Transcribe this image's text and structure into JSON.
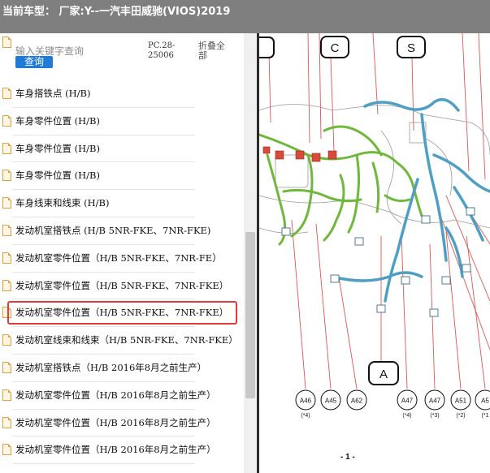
{
  "title": "当前车型：  厂家:Y--一汽丰田威驰(VIOS)2019",
  "search": {
    "placeholder": "输入关键字查询",
    "button": "查询"
  },
  "pc_code": "PC.28-25006",
  "collapse_all": "折叠全部",
  "list_items": [
    "车身搭铁点 (H/B)",
    "车身零件位置 (H/B)",
    "车身零件位置 (H/B)",
    "车身零件位置 (H/B)",
    "车身线束和线束 (H/B)",
    "发动机室搭铁点 (H/B 5NR-FKE、7NR-FKE)",
    "发动机室零件位置（H/B 5NR-FKE、7NR-FE）",
    "发动机室零件位置（H/B 5NR-FKE、7NR-FKE）",
    "发动机室零件位置（H/B 5NR-FKE、7NR-FKE）",
    "发动机室线束和线束（H/B 5NR-FKE、7NR-FKE）",
    "发动机室搭铁点（H/B 2016年8月之前生产）",
    "发动机室零件位置（H/B 2016年8月之前生产）",
    "发动机室零件位置（H/B 2016年8月之前生产）",
    "发动机室零件位置（H/B 2016年8月之前生产）"
  ],
  "selected_index": 8,
  "diagram": {
    "callouts_top": [
      "C",
      "S"
    ],
    "callout_bottom": "A",
    "connectors": [
      "A46",
      "A45",
      "A62",
      "A47",
      "A47",
      "A51",
      "A5"
    ],
    "connector_notes": [
      "(*4)",
      "(*4)",
      "(*3)",
      "(*2)",
      "(*1"
    ],
    "page_label": "- 1 -"
  },
  "colors": {
    "titlebar": "#7f7f7f",
    "button": "#1f7bd6",
    "highlight": "#e13b3b",
    "harness_green": "#7cc242",
    "harness_blue": "#5aa7c8"
  }
}
